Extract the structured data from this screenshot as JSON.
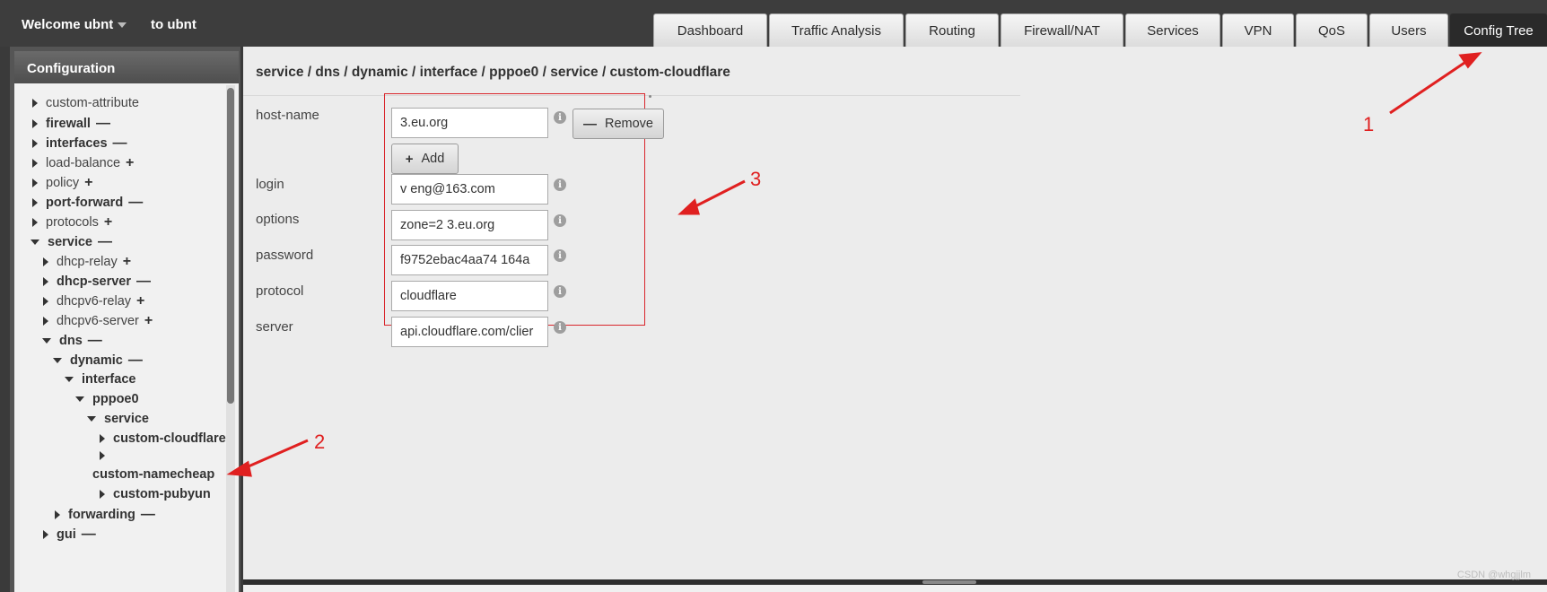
{
  "header": {
    "welcome": "Welcome ubnt",
    "to_user": "to ubnt",
    "tabs": [
      "Dashboard",
      "Traffic Analysis",
      "Routing",
      "Firewall/NAT",
      "Services",
      "VPN",
      "QoS",
      "Users",
      "Config Tree"
    ],
    "active_tab": "Config Tree"
  },
  "sidebar": {
    "title": "Configuration",
    "nodes": [
      {
        "label": "custom-attribute",
        "bold": false,
        "state": "closed",
        "sign": ""
      },
      {
        "label": "firewall",
        "bold": true,
        "state": "closed",
        "sign": "—"
      },
      {
        "label": "interfaces",
        "bold": true,
        "state": "closed",
        "sign": "—"
      },
      {
        "label": "load-balance",
        "bold": false,
        "state": "closed",
        "sign": "+"
      },
      {
        "label": "policy",
        "bold": false,
        "state": "closed",
        "sign": "+"
      },
      {
        "label": "port-forward",
        "bold": true,
        "state": "closed",
        "sign": "—"
      },
      {
        "label": "protocols",
        "bold": false,
        "state": "closed",
        "sign": "+"
      },
      {
        "label": "service",
        "bold": true,
        "state": "open",
        "sign": "—"
      },
      {
        "label": "dhcp-relay",
        "bold": false,
        "state": "closed",
        "sign": "+"
      },
      {
        "label": "dhcp-server",
        "bold": true,
        "state": "closed",
        "sign": "—"
      },
      {
        "label": "dhcpv6-relay",
        "bold": false,
        "state": "closed",
        "sign": "+"
      },
      {
        "label": "dhcpv6-server",
        "bold": false,
        "state": "closed",
        "sign": "+"
      },
      {
        "label": "dns",
        "bold": true,
        "state": "open",
        "sign": "—"
      },
      {
        "label": "dynamic",
        "bold": true,
        "state": "open",
        "sign": "—"
      },
      {
        "label": "interface",
        "bold": true,
        "state": "open",
        "sign": ""
      },
      {
        "label": "pppoe0",
        "bold": true,
        "state": "open",
        "sign": ""
      },
      {
        "label": "service",
        "bold": true,
        "state": "open",
        "sign": ""
      },
      {
        "label": "custom-cloudflare",
        "bold": true,
        "state": "closed",
        "sign": ""
      },
      {
        "label": "",
        "bold": false,
        "state": "closed",
        "sign": ""
      },
      {
        "label": "custom-namecheap",
        "bold": true,
        "state": "none",
        "sign": ""
      },
      {
        "label": "custom-pubyun",
        "bold": true,
        "state": "closed",
        "sign": ""
      },
      {
        "label": "forwarding",
        "bold": true,
        "state": "closed",
        "sign": "—"
      },
      {
        "label": "gui",
        "bold": true,
        "state": "closed",
        "sign": "—"
      }
    ]
  },
  "main": {
    "breadcrumb": "service / dns / dynamic / interface / pppoe0 / service / custom-cloudflare",
    "fields": {
      "host_name": {
        "label": "host-name",
        "value": "3.eu.org"
      },
      "login": {
        "label": "login",
        "value": "v   eng@163.com"
      },
      "options": {
        "label": "options",
        "value": "zone=2   3.eu.org"
      },
      "password": {
        "label": "password",
        "value": "f9752ebac4aa74    164a"
      },
      "protocol": {
        "label": "protocol",
        "value": "cloudflare"
      },
      "server": {
        "label": "server",
        "value": "api.cloudflare.com/clier"
      }
    },
    "remove_label": "Remove",
    "add_label": "Add",
    "info_glyph": "i"
  },
  "annotations": {
    "one": "1",
    "two": "2",
    "three": "3"
  },
  "watermark": "CSDN @whgjjlm",
  "colors": {
    "annotation": "#e02020",
    "active_tab": "#2a2a2a"
  }
}
